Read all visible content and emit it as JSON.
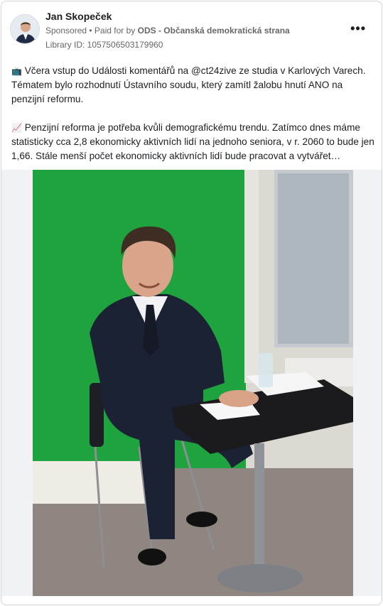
{
  "post": {
    "author": "Jan Skopeček",
    "sponsored": "Sponsored",
    "paid_for_prefix": "• Paid for by",
    "payer": "ODS - Občanská demokratická strana",
    "library_id": "Library ID: 1057506503179960",
    "more_label": "•••",
    "paragraph1_emoji": "📺",
    "paragraph1": "Včera vstup do Události komentářů na @ct24zive ze studia v Karlových Varech. Tématem bylo rozhodnutí Ústavního soudu, který zamítl žalobu hnutí ANO na penzijní reformu.",
    "paragraph2_emoji": "📈",
    "paragraph2": "Penzijní reforma je potřeba kvůli demografickému trendu. Zatímco dnes máme statisticky cca 2,8 ekonomicky aktivních lidí na jednoho seniora, v r. 2060 to bude jen 1,66. Stále menší počet ekonomicky aktivních lidí bude pracovat a vytvářet…"
  },
  "icons": {
    "tv": "tv-icon",
    "chart": "chart-increasing-icon",
    "more": "more-options-icon"
  },
  "colors": {
    "text": "#1c1e21",
    "secondary": "#65676b",
    "green_screen": "#1fa33f",
    "media_background": "#f0f2f5"
  }
}
